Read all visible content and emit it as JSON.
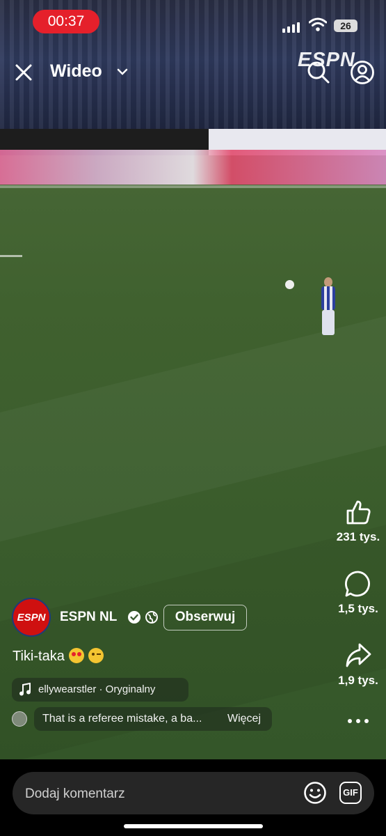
{
  "status_bar": {
    "recording_time": "00:37",
    "battery": "26"
  },
  "header": {
    "title": "Wideo",
    "watermark": "ESPN"
  },
  "actions": {
    "likes": "231 tys.",
    "comments": "1,5 tys.",
    "shares": "1,9 tys."
  },
  "post": {
    "avatar_logo": "ESPN",
    "account": "ESPN NL",
    "follow_label": "Obserwuj",
    "caption": "Tiki-taka",
    "audio": "ellywearstler · Oryginalny",
    "top_comment": "That is a referee mistake, a ba...",
    "more_label": "Więcej"
  },
  "comment_bar": {
    "placeholder": "Dodaj komentarz",
    "gif_label": "GIF"
  },
  "icons": [
    "close-icon",
    "chevron-down-icon",
    "search-icon",
    "profile-icon",
    "like-icon",
    "comment-icon",
    "share-icon",
    "more-icon",
    "verified-icon",
    "globe-icon",
    "music-note-icon",
    "emoji-icon",
    "gif-icon"
  ]
}
